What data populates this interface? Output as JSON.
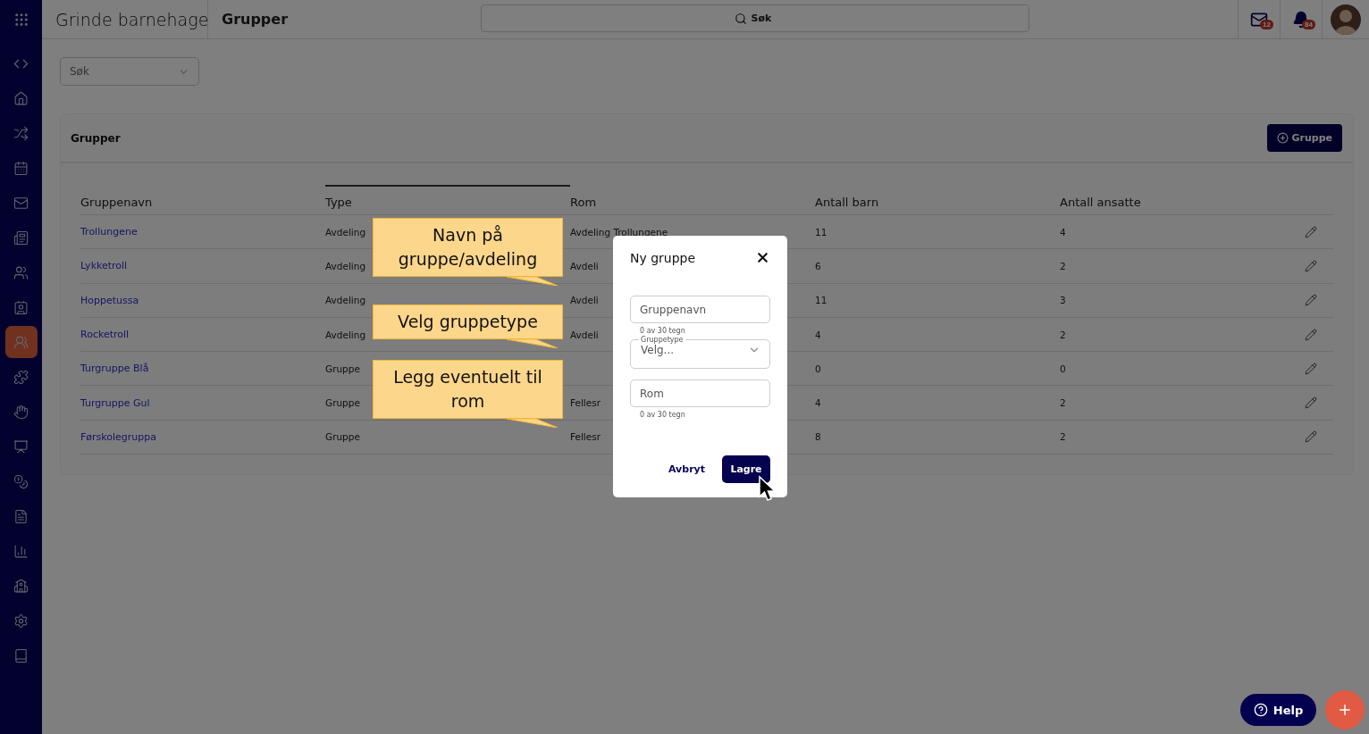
{
  "app": {
    "title": "Grinde barnehage",
    "page": "Grupper"
  },
  "search": {
    "placeholder": "Søk"
  },
  "notifications": [
    {
      "kind": "mail",
      "count": "12"
    },
    {
      "kind": "bell",
      "count": "84"
    }
  ],
  "sidebar": {
    "items": [
      {
        "selected": false
      },
      {
        "selected": false
      },
      {
        "selected": false
      },
      {
        "selected": false
      },
      {
        "selected": false
      },
      {
        "selected": false
      },
      {
        "selected": false
      },
      {
        "selected": false
      },
      {
        "selected": true
      },
      {
        "selected": false
      },
      {
        "selected": false
      },
      {
        "selected": false
      },
      {
        "selected": false
      },
      {
        "selected": false
      },
      {
        "selected": false
      },
      {
        "selected": false
      },
      {
        "selected": false
      },
      {
        "selected": false
      }
    ]
  },
  "filter": {
    "placeholder": "Søk"
  },
  "card": {
    "title": "Grupper",
    "add_button": "Gruppe"
  },
  "table": {
    "columns": [
      {
        "label": "Gruppenavn",
        "sorted": false
      },
      {
        "label": "Type",
        "sorted": true
      },
      {
        "label": "Rom",
        "sorted": false
      },
      {
        "label": "Antall barn",
        "sorted": false
      },
      {
        "label": "Antall ansatte",
        "sorted": false
      }
    ],
    "rows": [
      {
        "name": "Trollungene",
        "type": "Avdeling",
        "room": "Avdeling Trollungene",
        "child_count": "11",
        "staff_count": "4"
      },
      {
        "name": "Lykketroll",
        "type": "Avdeling",
        "room": "Avdeli",
        "child_count": "6",
        "staff_count": "2"
      },
      {
        "name": "Hoppetussa",
        "type": "Avdeling",
        "room": "Avdeli",
        "child_count": "11",
        "staff_count": "3"
      },
      {
        "name": "Rocketroll",
        "type": "Avdeling",
        "room": "Avdeli",
        "child_count": "4",
        "staff_count": "2"
      },
      {
        "name": "Turgruppe Blå",
        "type": "Gruppe",
        "child_count": "0",
        "staff_count": "0"
      },
      {
        "name": "Turgruppe Gul",
        "type": "Gruppe",
        "room": "Fellesr",
        "child_count": "4",
        "staff_count": "2"
      },
      {
        "name": "Førskolegruppa",
        "type": "Gruppe",
        "room": "Fellesr",
        "child_count": "8",
        "staff_count": "2"
      }
    ]
  },
  "callouts": [
    {
      "text": "Navn på gruppe/avdeling"
    },
    {
      "text": "Velg gruppetype"
    },
    {
      "text": "Legg eventuelt til rom"
    }
  ],
  "dialog": {
    "title": "Ny gruppe",
    "fields": [
      {
        "kind": "text",
        "placeholder": "Gruppenavn",
        "hint": "0 av 30 tegn"
      },
      {
        "kind": "select",
        "label": "Gruppetype",
        "value": "Velg..."
      },
      {
        "kind": "text",
        "placeholder": "Rom",
        "hint": "0 av 30 tegn"
      }
    ],
    "cancel": "Avbryt",
    "save": "Lagre"
  },
  "help": {
    "label": "Help"
  }
}
